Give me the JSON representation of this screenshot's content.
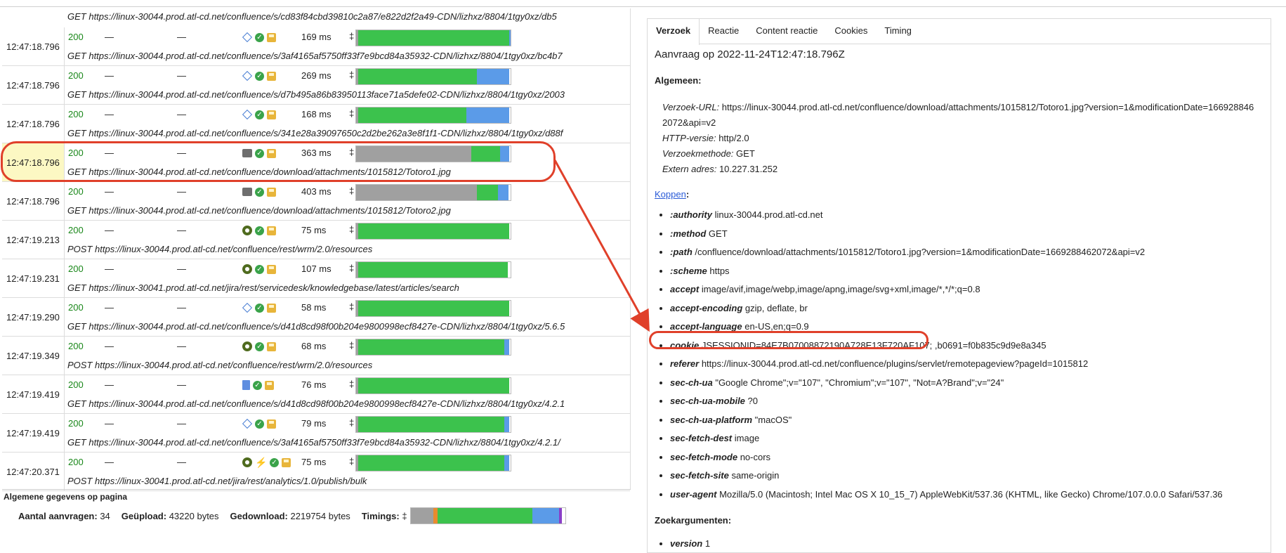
{
  "requests": {
    "first_url": "GET https://linux-30044.prod.atl-cd.net/confluence/s/cd83f84cbd39810c2a87/e822d2f2a49-CDN/lizhxz/8804/1tgy0xz/db5",
    "rows": [
      {
        "time": "12:47:18.796",
        "status": "200",
        "dash1": "—",
        "dash2": "—",
        "icons": [
          "diamond-icon",
          "check-icon",
          "save-icon"
        ],
        "duration": "169 ms",
        "bar": [
          0,
          1,
          0,
          0.99,
          0.01
        ],
        "url": "GET https://linux-30044.prod.atl-cd.net/confluence/s/3af4165af5750ff33f7e9bcd84a35932-CDN/lizhxz/8804/1tgy0xz/bc4b7",
        "selected": false
      },
      {
        "time": "12:47:18.796",
        "status": "200",
        "dash1": "—",
        "dash2": "—",
        "icons": [
          "diamond-icon",
          "check-icon",
          "save-icon"
        ],
        "duration": "269 ms",
        "bar": [
          0,
          1,
          0,
          0.78,
          0.21
        ],
        "url": "GET https://linux-30044.prod.atl-cd.net/confluence/s/d7b495a86b83950113face71a5defe02-CDN/lizhxz/8804/1tgy0xz/2003",
        "selected": false
      },
      {
        "time": "12:47:18.796",
        "status": "200",
        "dash1": "—",
        "dash2": "—",
        "icons": [
          "diamond-icon",
          "check-icon",
          "save-icon"
        ],
        "duration": "168 ms",
        "bar": [
          0,
          1,
          0,
          0.71,
          0.28
        ],
        "url": "GET https://linux-30044.prod.atl-cd.net/confluence/s/341e28a39097650c2d2be262a3e8f1f1-CDN/lizhxz/8804/1tgy0xz/d88f",
        "selected": false
      },
      {
        "time": "12:47:18.796",
        "status": "200",
        "dash1": "—",
        "dash2": "—",
        "icons": [
          "image-icon",
          "check-icon",
          "save-icon"
        ],
        "duration": "363 ms",
        "bar": [
          0.74,
          0,
          0,
          0.19,
          0.06
        ],
        "url": "GET https://linux-30044.prod.atl-cd.net/confluence/download/attachments/1015812/Totoro1.jpg",
        "selected": true
      },
      {
        "time": "12:47:18.796",
        "status": "200",
        "dash1": "—",
        "dash2": "—",
        "icons": [
          "image-icon",
          "check-icon",
          "save-icon"
        ],
        "duration": "403 ms",
        "bar": [
          0.78,
          0,
          0,
          0.14,
          0.07
        ],
        "url": "GET https://linux-30044.prod.atl-cd.net/confluence/download/attachments/1015812/Totoro2.jpg",
        "selected": false
      },
      {
        "time": "12:47:19.213",
        "status": "200",
        "dash1": "—",
        "dash2": "—",
        "icons": [
          "gear-icon",
          "check-icon",
          "save-icon"
        ],
        "duration": "75 ms",
        "bar": [
          0,
          1,
          0,
          0.99,
          0
        ],
        "url": "POST https://linux-30044.prod.atl-cd.net/confluence/rest/wrm/2.0/resources",
        "selected": false
      },
      {
        "time": "12:47:19.231",
        "status": "200",
        "dash1": "—",
        "dash2": "—",
        "icons": [
          "gear-icon",
          "check-icon",
          "save-icon"
        ],
        "duration": "107 ms",
        "bar": [
          0,
          1,
          0,
          0.98,
          0
        ],
        "url": "GET https://linux-30041.prod.atl-cd.net/jira/rest/servicedesk/knowledgebase/latest/articles/search",
        "selected": false
      },
      {
        "time": "12:47:19.290",
        "status": "200",
        "dash1": "—",
        "dash2": "—",
        "icons": [
          "diamond-icon",
          "check-icon",
          "save-icon"
        ],
        "duration": "58 ms",
        "bar": [
          0,
          1,
          0,
          0.99,
          0
        ],
        "url": "GET https://linux-30044.prod.atl-cd.net/confluence/s/d41d8cd98f00b204e9800998ecf8427e-CDN/lizhxz/8804/1tgy0xz/5.6.5",
        "selected": false
      },
      {
        "time": "12:47:19.349",
        "status": "200",
        "dash1": "—",
        "dash2": "—",
        "icons": [
          "gear-icon",
          "check-icon",
          "save-icon"
        ],
        "duration": "68 ms",
        "bar": [
          0,
          1,
          0,
          0.96,
          0.03
        ],
        "url": "POST https://linux-30044.prod.atl-cd.net/confluence/rest/wrm/2.0/resources",
        "selected": false
      },
      {
        "time": "12:47:19.419",
        "status": "200",
        "dash1": "—",
        "dash2": "—",
        "icons": [
          "doc-icon",
          "check-icon",
          "save-icon"
        ],
        "duration": "76 ms",
        "bar": [
          0,
          1,
          0,
          0.99,
          0
        ],
        "url": "GET https://linux-30044.prod.atl-cd.net/confluence/s/d41d8cd98f00b204e9800998ecf8427e-CDN/lizhxz/8804/1tgy0xz/4.2.1",
        "selected": false
      },
      {
        "time": "12:47:19.419",
        "status": "200",
        "dash1": "—",
        "dash2": "—",
        "icons": [
          "diamond-icon",
          "check-icon",
          "save-icon"
        ],
        "duration": "79 ms",
        "bar": [
          0,
          1,
          0,
          0.96,
          0.03
        ],
        "url": "GET https://linux-30044.prod.atl-cd.net/confluence/s/3af4165af5750ff33f7e9bcd84a35932-CDN/lizhxz/8804/1tgy0xz/4.2.1/",
        "selected": false
      },
      {
        "time": "12:47:20.371",
        "status": "200",
        "dash1": "—",
        "dash2": "—",
        "icons": [
          "gear-icon",
          "no-connection-icon",
          "check-icon",
          "save-icon"
        ],
        "duration": "75 ms",
        "bar": [
          0,
          1,
          0,
          0.96,
          0.03
        ],
        "url": "POST https://linux-30041.prod.atl-cd.net/jira/rest/analytics/1.0/publish/bulk",
        "selected": false
      }
    ]
  },
  "sort_glyph": "‡",
  "bar_colors": {
    "blocked": "#a0a0a0",
    "connect": "#e98b2e",
    "wait": "#3cc24d",
    "receive": "#5b9be8",
    "end": "#8a3fc7"
  },
  "summary": {
    "title": "Algemene gegevens op pagina",
    "requests_label": "Aantal aanvragen:",
    "requests_value": "34",
    "upload_label": "Geüpload:",
    "upload_value": "43220 bytes",
    "download_label": "Gedownload:",
    "download_value": "2219754 bytes",
    "timings_label": "Timings:"
  },
  "detail": {
    "tabs": [
      "Verzoek",
      "Reactie",
      "Content reactie",
      "Cookies",
      "Timing"
    ],
    "active_tab": "Verzoek",
    "request_title": "Aanvraag op 2022-11-24T12:47:18.796Z",
    "general_heading": "Algemeen:",
    "url_label": "Verzoek-URL:",
    "url_value": "https://linux-30044.prod.atl-cd.net/confluence/download/attachments/1015812/Totoro1.jpg?version=1&modificationDate=1669288462072&api=v2",
    "http_label": "HTTP-versie:",
    "http_value": "http/2.0",
    "method_label": "Verzoekmethode:",
    "method_value": "GET",
    "addr_label": "Extern adres:",
    "addr_value": "10.227.31.252",
    "headers_link": "Koppen",
    "headers_colon": ":",
    "headers": [
      {
        "name": ":authority",
        "value": "linux-30044.prod.atl-cd.net"
      },
      {
        "name": ":method",
        "value": "GET"
      },
      {
        "name": ":path",
        "value": "/confluence/download/attachments/1015812/Totoro1.jpg?version=1&modificationDate=1669288462072&api=v2"
      },
      {
        "name": ":scheme",
        "value": "https"
      },
      {
        "name": "accept",
        "value": "image/avif,image/webp,image/apng,image/svg+xml,image/*,*/*;q=0.8"
      },
      {
        "name": "accept-encoding",
        "value": "gzip, deflate, br"
      },
      {
        "name": "accept-language",
        "value": "en-US,en;q=0.9"
      },
      {
        "name": "cookie",
        "value": "JSESSIONID=84E7B07008872190A728E13F720AF107; ,b0691=f0b835c9d9e8a345"
      },
      {
        "name": "referer",
        "value": "https://linux-30044.prod.atl-cd.net/confluence/plugins/servlet/remotepageview?pageId=1015812"
      },
      {
        "name": "sec-ch-ua",
        "value": "\"Google Chrome\";v=\"107\", \"Chromium\";v=\"107\", \"Not=A?Brand\";v=\"24\""
      },
      {
        "name": "sec-ch-ua-mobile",
        "value": "?0"
      },
      {
        "name": "sec-ch-ua-platform",
        "value": "\"macOS\""
      },
      {
        "name": "sec-fetch-dest",
        "value": "image"
      },
      {
        "name": "sec-fetch-mode",
        "value": "no-cors"
      },
      {
        "name": "sec-fetch-site",
        "value": "same-origin"
      },
      {
        "name": "user-agent",
        "value": "Mozilla/5.0 (Macintosh; Intel Mac OS X 10_15_7) AppleWebKit/537.36 (KHTML, like Gecko) Chrome/107.0.0.0 Safari/537.36"
      }
    ],
    "query_heading": "Zoekargumenten:",
    "query_args": [
      {
        "name": "version",
        "value": "1"
      }
    ]
  }
}
